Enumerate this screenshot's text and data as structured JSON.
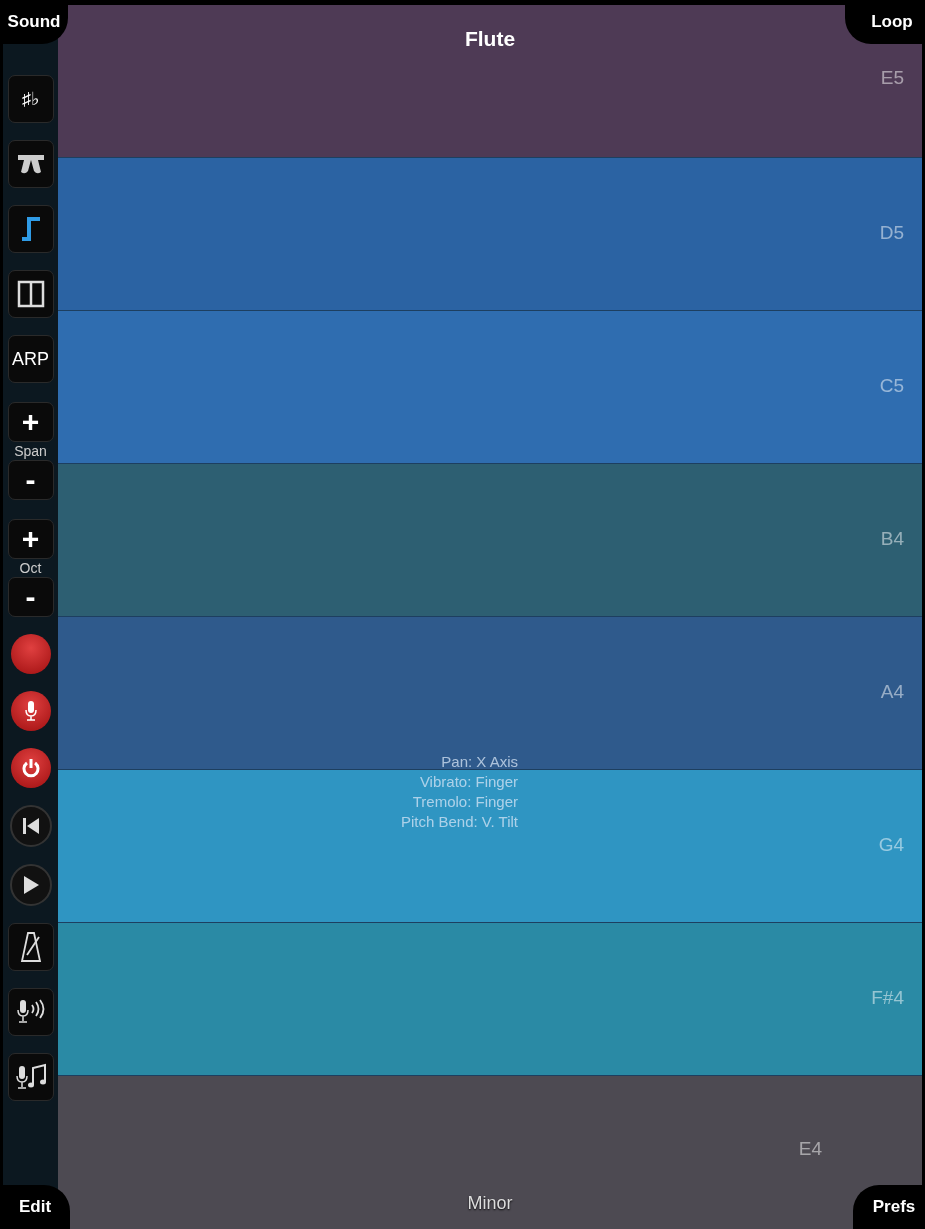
{
  "title": "Flute",
  "corner_buttons": {
    "top_left": "Sound",
    "top_right": "Loop",
    "bottom_left": "Edit",
    "bottom_right": "Prefs"
  },
  "sidebar": [
    {
      "kind": "text",
      "label": "♯♭"
    },
    {
      "kind": "pedal"
    },
    {
      "kind": "glide"
    },
    {
      "kind": "split"
    },
    {
      "kind": "text",
      "label": "ARP"
    },
    {
      "kind": "stepper",
      "up": "+",
      "label": "Span",
      "down": "-"
    },
    {
      "kind": "stepper",
      "up": "+",
      "label": "Oct",
      "down": "-"
    },
    {
      "kind": "record"
    },
    {
      "kind": "mic"
    },
    {
      "kind": "timer"
    },
    {
      "kind": "rewind"
    },
    {
      "kind": "play"
    },
    {
      "kind": "metronome"
    },
    {
      "kind": "micsound"
    },
    {
      "kind": "micnote"
    }
  ],
  "rows": [
    {
      "note": "E5",
      "color": "#4e3a55"
    },
    {
      "note": "D5",
      "color": "#2b63a3"
    },
    {
      "note": "C5",
      "color": "#2f6db0"
    },
    {
      "note": "B4",
      "color": "#2d5f72"
    },
    {
      "note": "A4",
      "color": "#2f5a8c"
    },
    {
      "note": "G4",
      "color": "#2f95c2"
    },
    {
      "note": "F#4",
      "color": "#2a8aa5"
    },
    {
      "note": "E4",
      "color": "#4d4a52"
    }
  ],
  "mappings": [
    "Pan: X Axis",
    "Vibrato: Finger",
    "Tremolo: Finger",
    "Pitch Bend: V. Tilt"
  ],
  "scale": "Minor"
}
